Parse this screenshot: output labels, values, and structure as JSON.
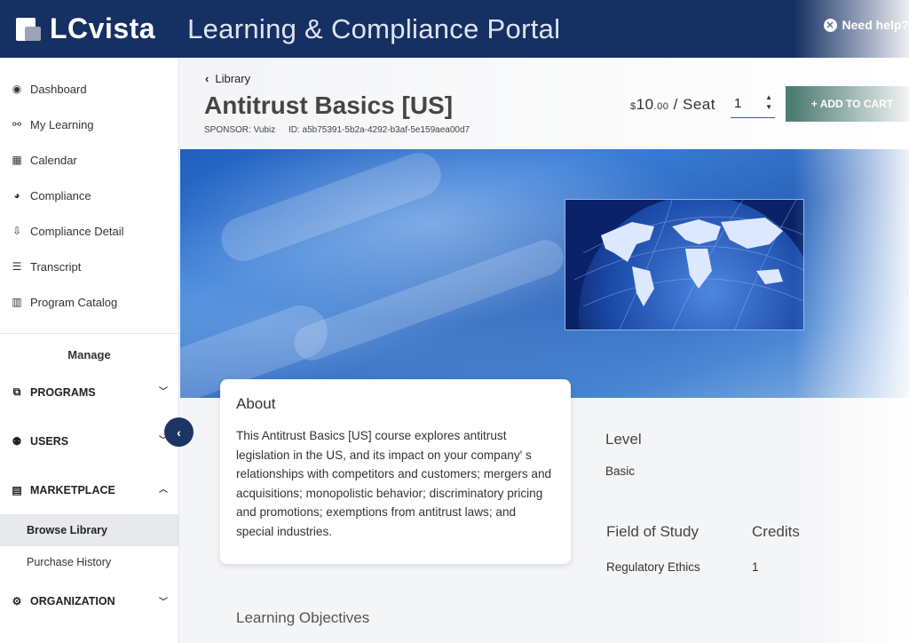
{
  "header": {
    "logo_text": "LCvista",
    "portal_title": "Learning & Compliance Portal",
    "help_label": "Need help?"
  },
  "sidebar": {
    "items": [
      {
        "label": "Dashboard",
        "icon": "dashboard-icon"
      },
      {
        "label": "My Learning",
        "icon": "learning-icon"
      },
      {
        "label": "Calendar",
        "icon": "calendar-icon"
      },
      {
        "label": "Compliance",
        "icon": "pie-chart-icon"
      },
      {
        "label": "Compliance Detail",
        "icon": "compliance-detail-icon"
      },
      {
        "label": "Transcript",
        "icon": "list-icon"
      },
      {
        "label": "Program Catalog",
        "icon": "book-icon"
      }
    ],
    "manage_label": "Manage",
    "sections": {
      "programs": "PROGRAMS",
      "users": "USERS",
      "marketplace": "MARKETPLACE",
      "organization": "ORGANIZATION"
    },
    "marketplace_items": [
      "Browse Library",
      "Purchase History"
    ],
    "active_item": "Browse Library"
  },
  "course": {
    "breadcrumb": "Library",
    "title": "Antitrust Basics [US]",
    "sponsor": "SPONSOR: Vubiz",
    "id": "ID: a5b75391-5b2a-4292-b3af-5e159aea00d7",
    "price_currency": "$",
    "price_whole": "10",
    "price_cents": ".00",
    "price_unit": " / Seat",
    "quantity": "1",
    "add_to_cart": "+ ADD TO CART"
  },
  "about": {
    "title": "About",
    "body": "This Antitrust Basics [US] course explores antitrust legislation in the US, and its impact on your company' s relationships with competitors and customers; mergers and acquisitions; monopolistic behavior; discriminatory pricing and promotions; exemptions from antitrust laws; and special industries."
  },
  "details": {
    "level_label": "Level",
    "level_value": "Basic",
    "field_label": "Field of Study",
    "field_value": "Regulatory Ethics",
    "credits_label": "Credits",
    "credits_value": "1"
  },
  "learning_objectives_label": "Learning Objectives",
  "colors": {
    "header_bg": "#153063",
    "add_to_cart_bg": "#4f7d74",
    "collapse_button_bg": "#1c3565"
  }
}
